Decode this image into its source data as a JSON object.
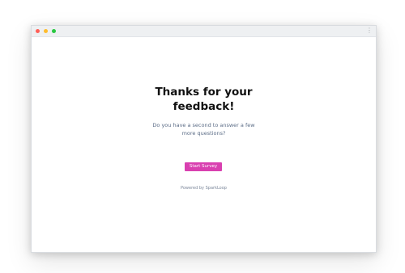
{
  "window": {
    "controls": {
      "close_color": "#ff5f57",
      "minimize_color": "#febc2e",
      "maximize_color": "#28c840"
    },
    "menu_icon": "more-vertical-icon",
    "menu_glyph": "⋮"
  },
  "survey": {
    "heading_line1": "Thanks for your",
    "heading_line2": "feedback!",
    "subtext_line1": "Do you have a second to answer a few",
    "subtext_line2": "more questions?",
    "start_button_label": "Start Survey",
    "start_button_color": "#d940b0",
    "powered_by": "Powered by SparkLoop"
  }
}
